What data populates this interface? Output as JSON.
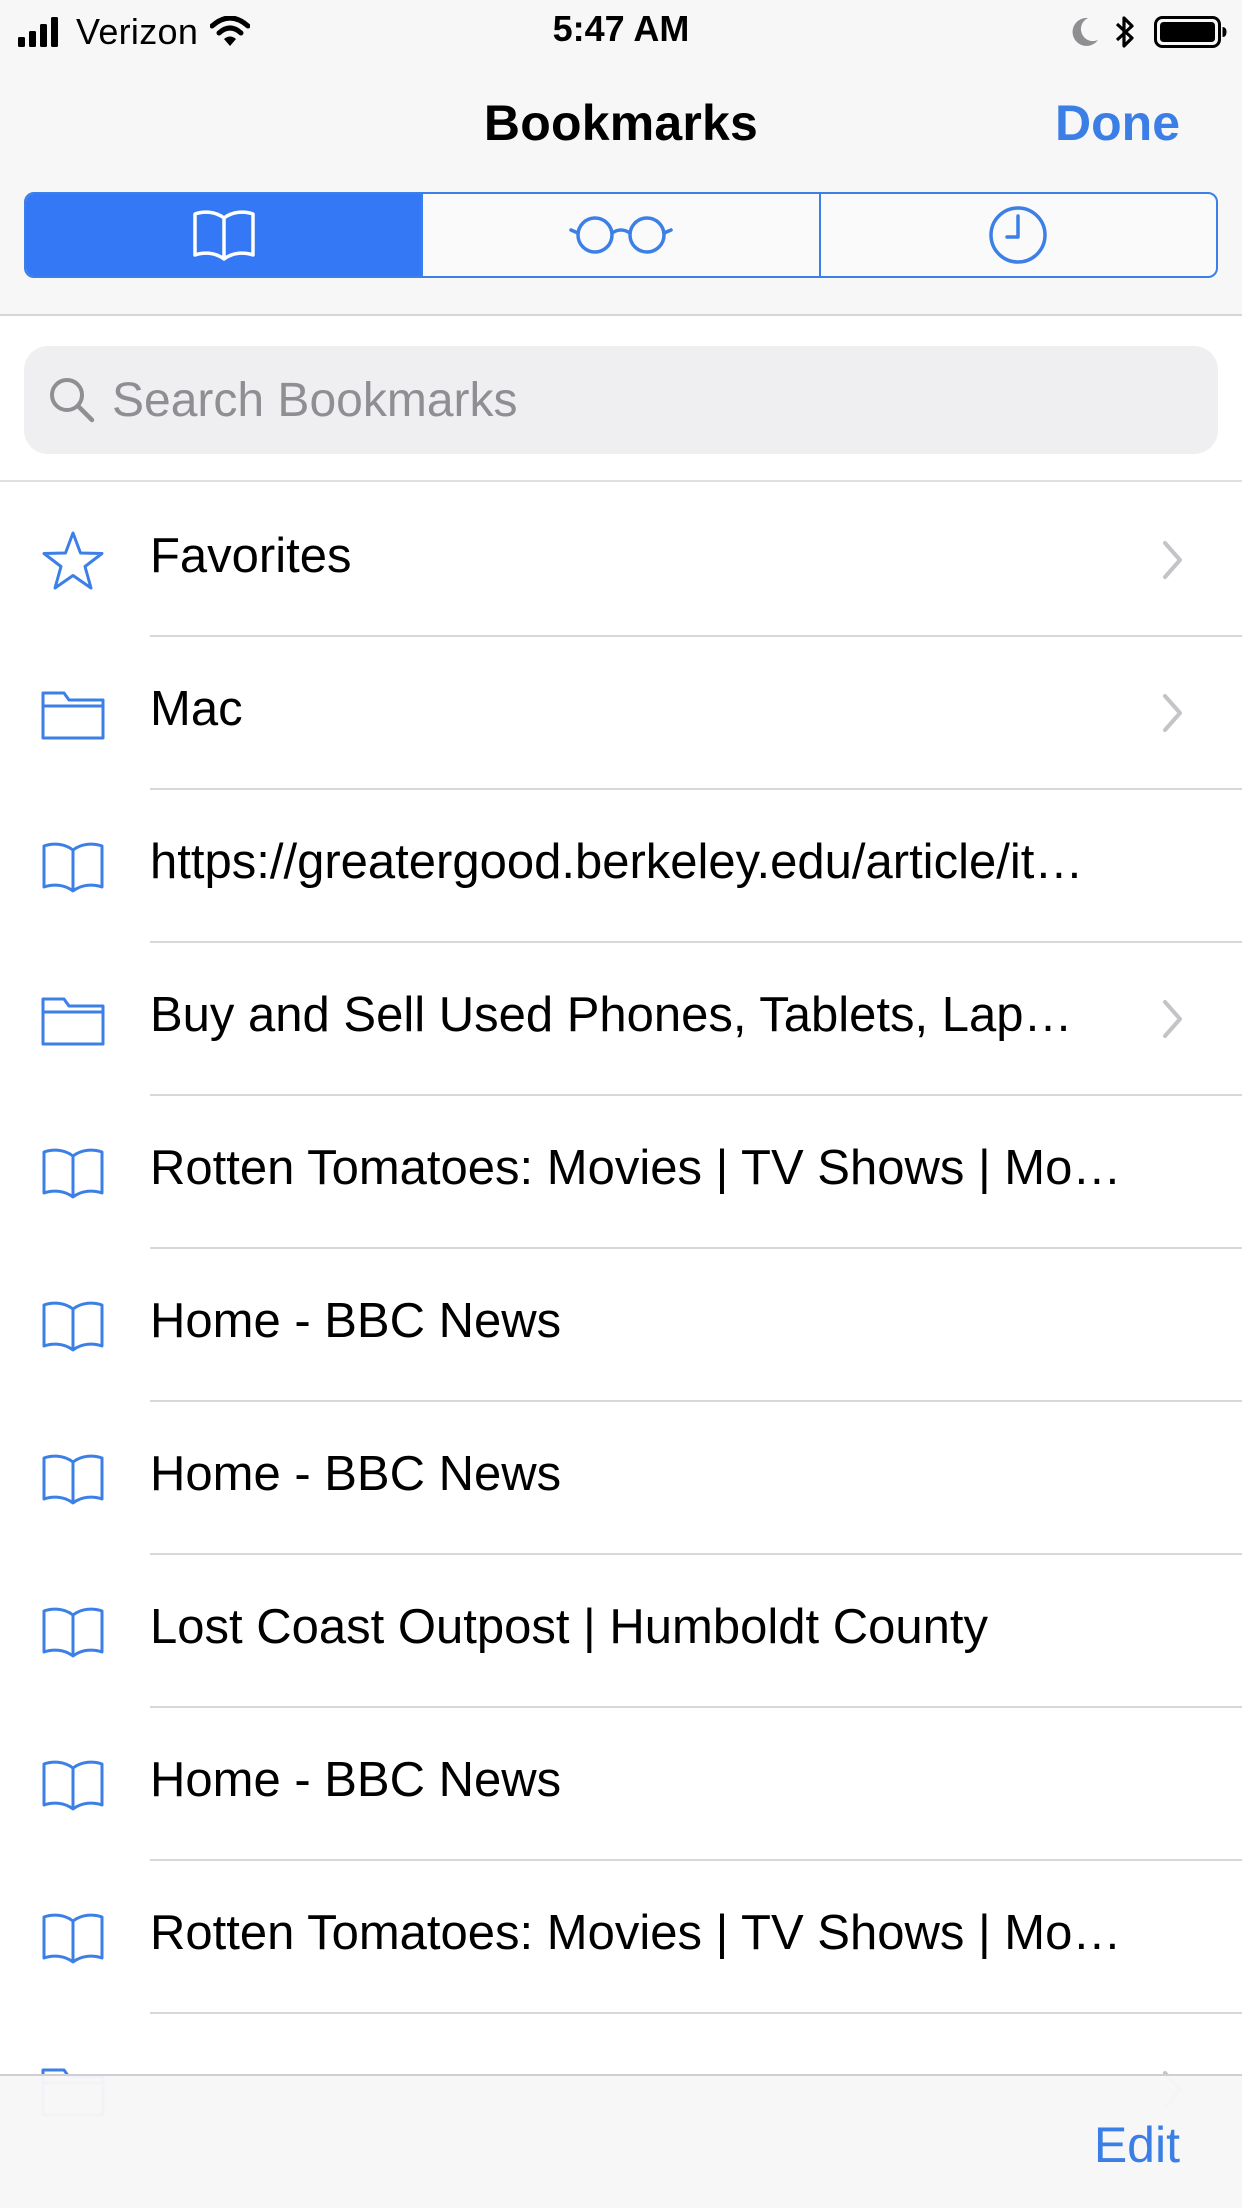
{
  "status_bar": {
    "carrier": "Verizon",
    "time": "5:47 AM"
  },
  "nav": {
    "title": "Bookmarks",
    "done_label": "Done"
  },
  "tabs": [
    {
      "icon": "book-icon",
      "active": true
    },
    {
      "icon": "glasses-icon",
      "active": false
    },
    {
      "icon": "clock-icon",
      "active": false
    }
  ],
  "search": {
    "placeholder": "Search Bookmarks",
    "value": ""
  },
  "items": [
    {
      "icon": "star-icon",
      "label": "Favorites",
      "chevron": true
    },
    {
      "icon": "folder-icon",
      "label": "Mac",
      "chevron": true
    },
    {
      "icon": "book-icon",
      "label": "https://greatergood.berkeley.edu/article/it…",
      "chevron": false
    },
    {
      "icon": "folder-icon",
      "label": "Buy and Sell Used Phones, Tablets, Lap…",
      "chevron": true
    },
    {
      "icon": "book-icon",
      "label": "Rotten Tomatoes: Movies | TV Shows | Mo…",
      "chevron": false
    },
    {
      "icon": "book-icon",
      "label": "Home - BBC News",
      "chevron": false
    },
    {
      "icon": "book-icon",
      "label": "Home - BBC News",
      "chevron": false
    },
    {
      "icon": "book-icon",
      "label": "Lost Coast Outpost | Humboldt County",
      "chevron": false
    },
    {
      "icon": "book-icon",
      "label": "Home - BBC News",
      "chevron": false
    },
    {
      "icon": "book-icon",
      "label": "Rotten Tomatoes: Movies | TV Shows | Mo…",
      "chevron": false
    },
    {
      "icon": "folder-icon",
      "label": "",
      "chevron": true
    }
  ],
  "toolbar": {
    "edit_label": "Edit"
  },
  "colors": {
    "accent": "#3478f6",
    "icon": "#3c7fe6",
    "separator": "#d8d8dc"
  }
}
